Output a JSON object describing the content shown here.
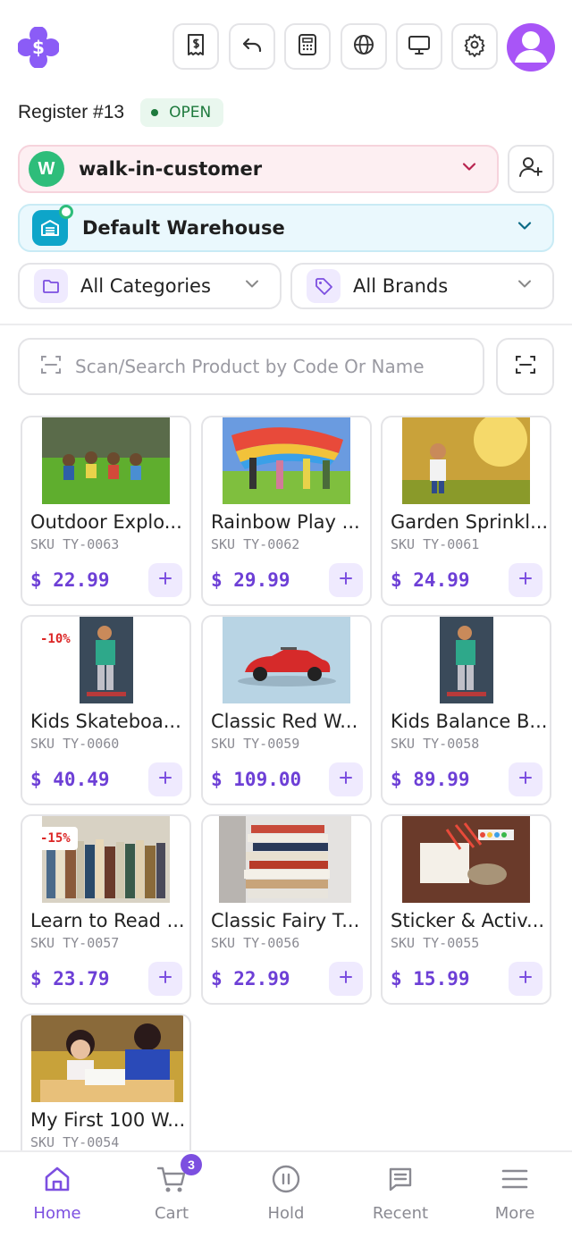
{
  "header": {
    "logo_icon": "dollar-badge-logo-icon",
    "toolbar": [
      {
        "name": "receipt-dollar-icon"
      },
      {
        "name": "undo-icon"
      },
      {
        "name": "calculator-icon"
      },
      {
        "name": "globe-icon"
      },
      {
        "name": "monitor-icon"
      },
      {
        "name": "settings-gear-icon"
      }
    ],
    "avatar_icon": "user-avatar-icon"
  },
  "register": {
    "title": "Register #13",
    "status": "OPEN"
  },
  "customer": {
    "initial": "W",
    "name": "walk-in-customer"
  },
  "warehouse": {
    "name": "Default Warehouse"
  },
  "filters": {
    "category": "All Categories",
    "brand": "All Brands"
  },
  "search": {
    "placeholder": "Scan/Search Product by Code Or Name"
  },
  "products": [
    {
      "name": "Outdoor Explo...",
      "sku": "SKU TY-0063",
      "price": "$ 22.99",
      "discount": ""
    },
    {
      "name": "Rainbow Play ...",
      "sku": "SKU TY-0062",
      "price": "$ 29.99",
      "discount": ""
    },
    {
      "name": "Garden Sprinkl...",
      "sku": "SKU TY-0061",
      "price": "$ 24.99",
      "discount": ""
    },
    {
      "name": "Kids Skateboa...",
      "sku": "SKU TY-0060",
      "price": "$ 40.49",
      "discount": "-10%"
    },
    {
      "name": "Classic Red W...",
      "sku": "SKU TY-0059",
      "price": "$ 109.00",
      "discount": ""
    },
    {
      "name": "Kids Balance B...",
      "sku": "SKU TY-0058",
      "price": "$ 89.99",
      "discount": ""
    },
    {
      "name": "Learn to Read ...",
      "sku": "SKU TY-0057",
      "price": "$ 23.79",
      "discount": "-15%"
    },
    {
      "name": "Classic Fairy T...",
      "sku": "SKU TY-0056",
      "price": "$ 22.99",
      "discount": ""
    },
    {
      "name": "Sticker & Activ...",
      "sku": "SKU TY-0055",
      "price": "$ 15.99",
      "discount": ""
    },
    {
      "name": "My First 100 W...",
      "sku": "SKU TY-0054",
      "price": "",
      "discount": ""
    }
  ],
  "nav": {
    "items": [
      {
        "label": "Home",
        "icon": "home-icon"
      },
      {
        "label": "Cart",
        "icon": "cart-icon",
        "badge": "3"
      },
      {
        "label": "Hold",
        "icon": "pause-icon"
      },
      {
        "label": "Recent",
        "icon": "receipt-list-icon"
      },
      {
        "label": "More",
        "icon": "menu-icon"
      }
    ]
  },
  "colors": {
    "accent": "#7c4fe0",
    "open_green": "#1e7a3d",
    "discount_red": "#dc2626"
  }
}
